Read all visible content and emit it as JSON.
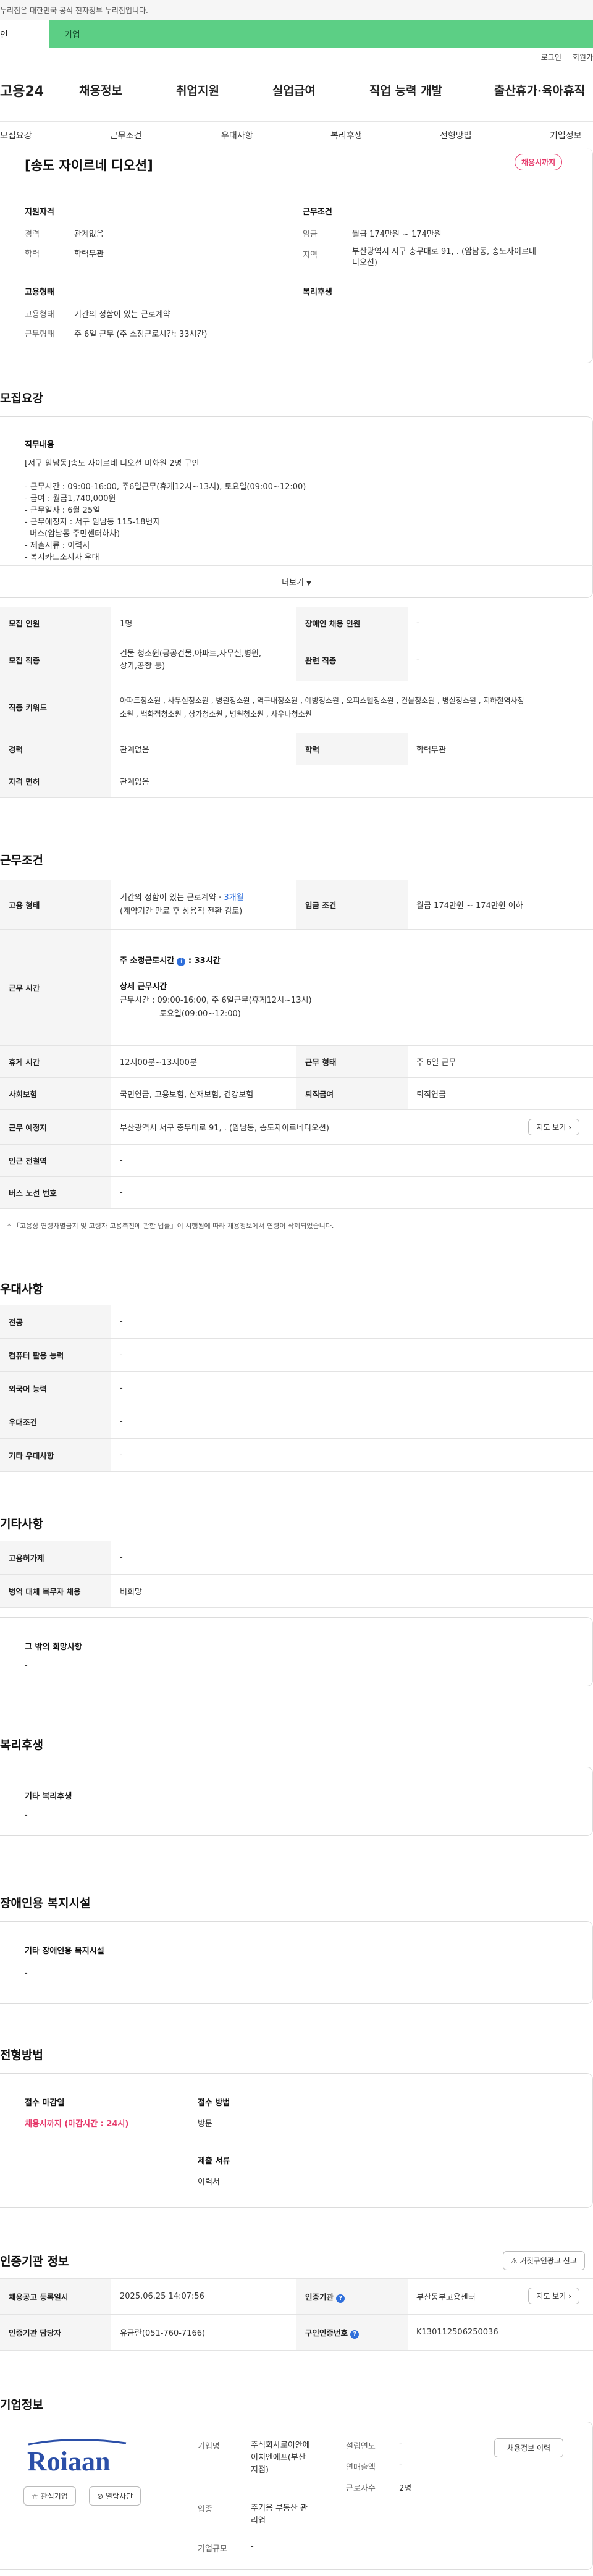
{
  "gov_banner": "누리집은 대한민국 공식 전자정부 누리집입니다.",
  "audience_tabs": {
    "individual": "인",
    "corporate": "기업"
  },
  "util": {
    "login": "로그인",
    "signup": "회원가"
  },
  "gnb": {
    "logo": "고용24",
    "items": [
      "채용정보",
      "취업지원",
      "실업급여",
      "직업 능력 개발",
      "출산휴가·육아휴직"
    ]
  },
  "lnb": [
    "모집요강",
    "근무조건",
    "우대사항",
    "복리후생",
    "전형방법",
    "기업정보"
  ],
  "summary": {
    "title": "[송도 자이르네 디오션]",
    "deadline_pill": "채용시까지",
    "qualification_title": "지원자격",
    "career_label": "경력",
    "career_value": "관계없음",
    "edu_label": "학력",
    "edu_value": "학력무관",
    "conditions_title": "근무조건",
    "wage_label": "임금",
    "wage_value": "월급 174만원 ~ 174만원",
    "region_label": "지역",
    "region_value_1": "부산광역시 서구 충무대로 91, . (암남동, 송도자이르네",
    "region_value_2": "디오션)",
    "employment_title": "고용형태",
    "etype_label": "고용형태",
    "etype_value": "기간의 정함이 있는 근로계약",
    "wtype_label": "근무형태",
    "wtype_value": "주 6일 근무 (주 소정근로시간: 33시간)",
    "welfare_title": "복리후생"
  },
  "recruit": {
    "heading": "모집요강",
    "duty_title": "직무내용",
    "duty_lines": [
      "[서구 암남동]송도 자이르네 디오션 미화원 2명 구인",
      "",
      "- 근무시간 : 09:00-16:00, 주6일근무(휴게12시~13시), 토요일(09:00~12:00)",
      "- 급여 : 월급1,740,000원",
      "- 근무일자 : 6월 25일",
      "- 근무예정지 : 서구 암남동 115-18번지",
      "  버스(암남동 주민센터하차)",
      "- 제출서류 : 이력서",
      "- 복지카드소지자 우대"
    ],
    "more": "더보기",
    "rows": [
      [
        "모집 인원",
        "1명",
        "장애인 채용 인원",
        "-"
      ],
      [
        "모집 직종",
        "건물 청소원(공공건물,아파트,사무실,병원,\n상가,공항 등)",
        "관련 직종",
        "-"
      ],
      [
        "직종 키워드",
        "아파트청소원 , 사무실청소원 , 병원청소원 , 역구내청소원 , 예방청소원 , 오피스텔청소원 , 건물청소원 , 병실청소원 , 지하철역사청\n소원 , 백화점청소원 , 상가청소원 , 병원청소원 , 사우나청소원"
      ],
      [
        "경력",
        "관계없음",
        "학력",
        "학력무관"
      ],
      [
        "자격 면허",
        "관계없음"
      ]
    ]
  },
  "work": {
    "heading": "근무조건",
    "etype_label": "고용 형태",
    "etype_value": "기간의 정함이 있는 근로계약 · ",
    "etype_months": "3개월",
    "etype_sub": "(계약기간 만료 후 상용직 전환 검토)",
    "wage_label": "임금 조건",
    "wage_value": "월급 174만원 ~ 174만원 이하",
    "hours_label": "근무 시간",
    "hours_total": "주 소정근로시간",
    "hours_total_value": " : 33시간",
    "hours_detail_title": "상세 근무시간",
    "hours_detail_1": "근무시간 : 09:00-16:00, 주 6일근무(휴게12시~13시)",
    "hours_detail_2": "토요일(09:00~12:00)",
    "rows": [
      [
        "휴게 시간",
        "12시00분~13시00분",
        "근무 형태",
        "주 6일 근무"
      ],
      [
        "사회보험",
        "국민연금, 고용보험, 산재보험, 건강보험",
        "퇴직급여",
        "퇴직연금"
      ],
      [
        "근무 예정지",
        "부산광역시 서구 충무대로 91, . (암남동, 송도자이르네디오션)"
      ],
      [
        "인근 전철역",
        "-"
      ],
      [
        "버스 노선 번호",
        "-"
      ]
    ],
    "map_button": "지도 보기",
    "note": "* 「고용상 연령차별금지 및 고령자 고용촉진에 관한 법률」이 시행됨에 따라 채용정보에서 연령이 삭제되었습니다."
  },
  "pref": {
    "heading": "우대사항",
    "rows": [
      [
        "전공",
        "-"
      ],
      [
        "컴퓨터 활용 능력",
        "-"
      ],
      [
        "외국어 능력",
        "-"
      ],
      [
        "우대조건",
        "-"
      ],
      [
        "기타 우대사항",
        "-"
      ]
    ]
  },
  "other": {
    "heading": "기타사항",
    "rows": [
      [
        "고용허가제",
        "-"
      ],
      [
        "병역 대체 복무자 채용",
        "비희망"
      ]
    ],
    "box_title": "그 밖의 희망사항",
    "box_value": "-"
  },
  "welfare": {
    "heading": "복리후생",
    "box_title": "기타 복리후생",
    "box_value": "-"
  },
  "disabled": {
    "heading": "장애인용 복지시설",
    "box_title": "기타 장애인용 복지시설",
    "box_value": "-"
  },
  "selection": {
    "heading": "전형방법",
    "deadline_title": "접수 마감일",
    "deadline_value": "채용시까지 (마감시간 : 24시)",
    "method_title": "접수 방법",
    "method_value": "방문",
    "docs_title": "제출 서류",
    "docs_value": "이력서"
  },
  "auth": {
    "heading": "인증기관 정보",
    "report_button": "거짓구인광고 신고",
    "rows": [
      [
        "채용공고 등록일시",
        "2025.06.25 14:07:56",
        "인증기관",
        "부산동부고용센터"
      ],
      [
        "인증기관 담당자",
        "유금란(051-760-7166)",
        "구인인증번호",
        "K130112506250036"
      ]
    ],
    "map_button": "지도 보기"
  },
  "company": {
    "heading": "기업정보",
    "logo_text": "Roiaan",
    "fav_button": "관심기업",
    "block_button": "열람차단",
    "name_label": "기업명",
    "name_value": "주식회사로이안에\n이치엔에프(부산\n지점)",
    "industry_label": "업종",
    "industry_value": "주거용 부동산 관\n리업",
    "scale_label": "기업규모",
    "scale_value": "-",
    "founded_label": "설립연도",
    "founded_value": "-",
    "sales_label": "연매출액",
    "sales_value": "-",
    "employees_label": "근로자수",
    "employees_value": "2명",
    "history_button": "채용정보 이력"
  },
  "colors": {
    "accent_green": "#5ccf85",
    "deadline_red": "#e6386a",
    "info_blue": "#2f6fdb"
  }
}
